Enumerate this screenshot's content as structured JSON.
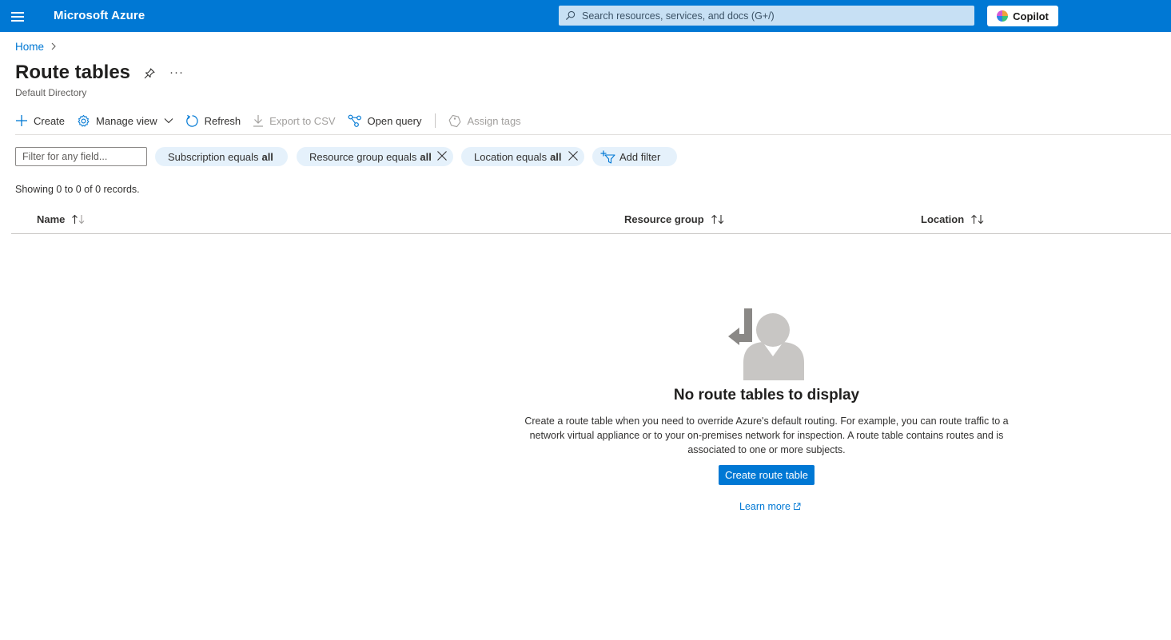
{
  "topbar": {
    "brand": "Microsoft Azure",
    "search_placeholder": "Search resources, services, and docs (G+/)",
    "copilot_label": "Copilot",
    "accent": "#0078d4"
  },
  "breadcrumb": {
    "home": "Home"
  },
  "page": {
    "title": "Route tables",
    "subtitle": "Default Directory"
  },
  "toolbar": {
    "create": "Create",
    "manage_view": "Manage view",
    "refresh": "Refresh",
    "export_csv": "Export to CSV",
    "open_query": "Open query",
    "assign_tags": "Assign tags"
  },
  "filters": {
    "placeholder": "Filter for any field...",
    "subscription_label": "Subscription equals",
    "subscription_value": "all",
    "resource_group_label": "Resource group equals",
    "resource_group_value": "all",
    "location_label": "Location equals",
    "location_value": "all",
    "add_filter": "Add filter"
  },
  "records_text": "Showing 0 to 0 of 0 records.",
  "table": {
    "columns": [
      "Name",
      "Resource group",
      "Location"
    ]
  },
  "empty_state": {
    "title": "No route tables to display",
    "description": "Create a route table when you need to override Azure's default routing. For example, you can route traffic to a network virtual appliance or to your on-premises network for inspection. A route table contains routes and is associated to one or more subjects.",
    "button": "Create route table",
    "learn_more": "Learn more"
  }
}
